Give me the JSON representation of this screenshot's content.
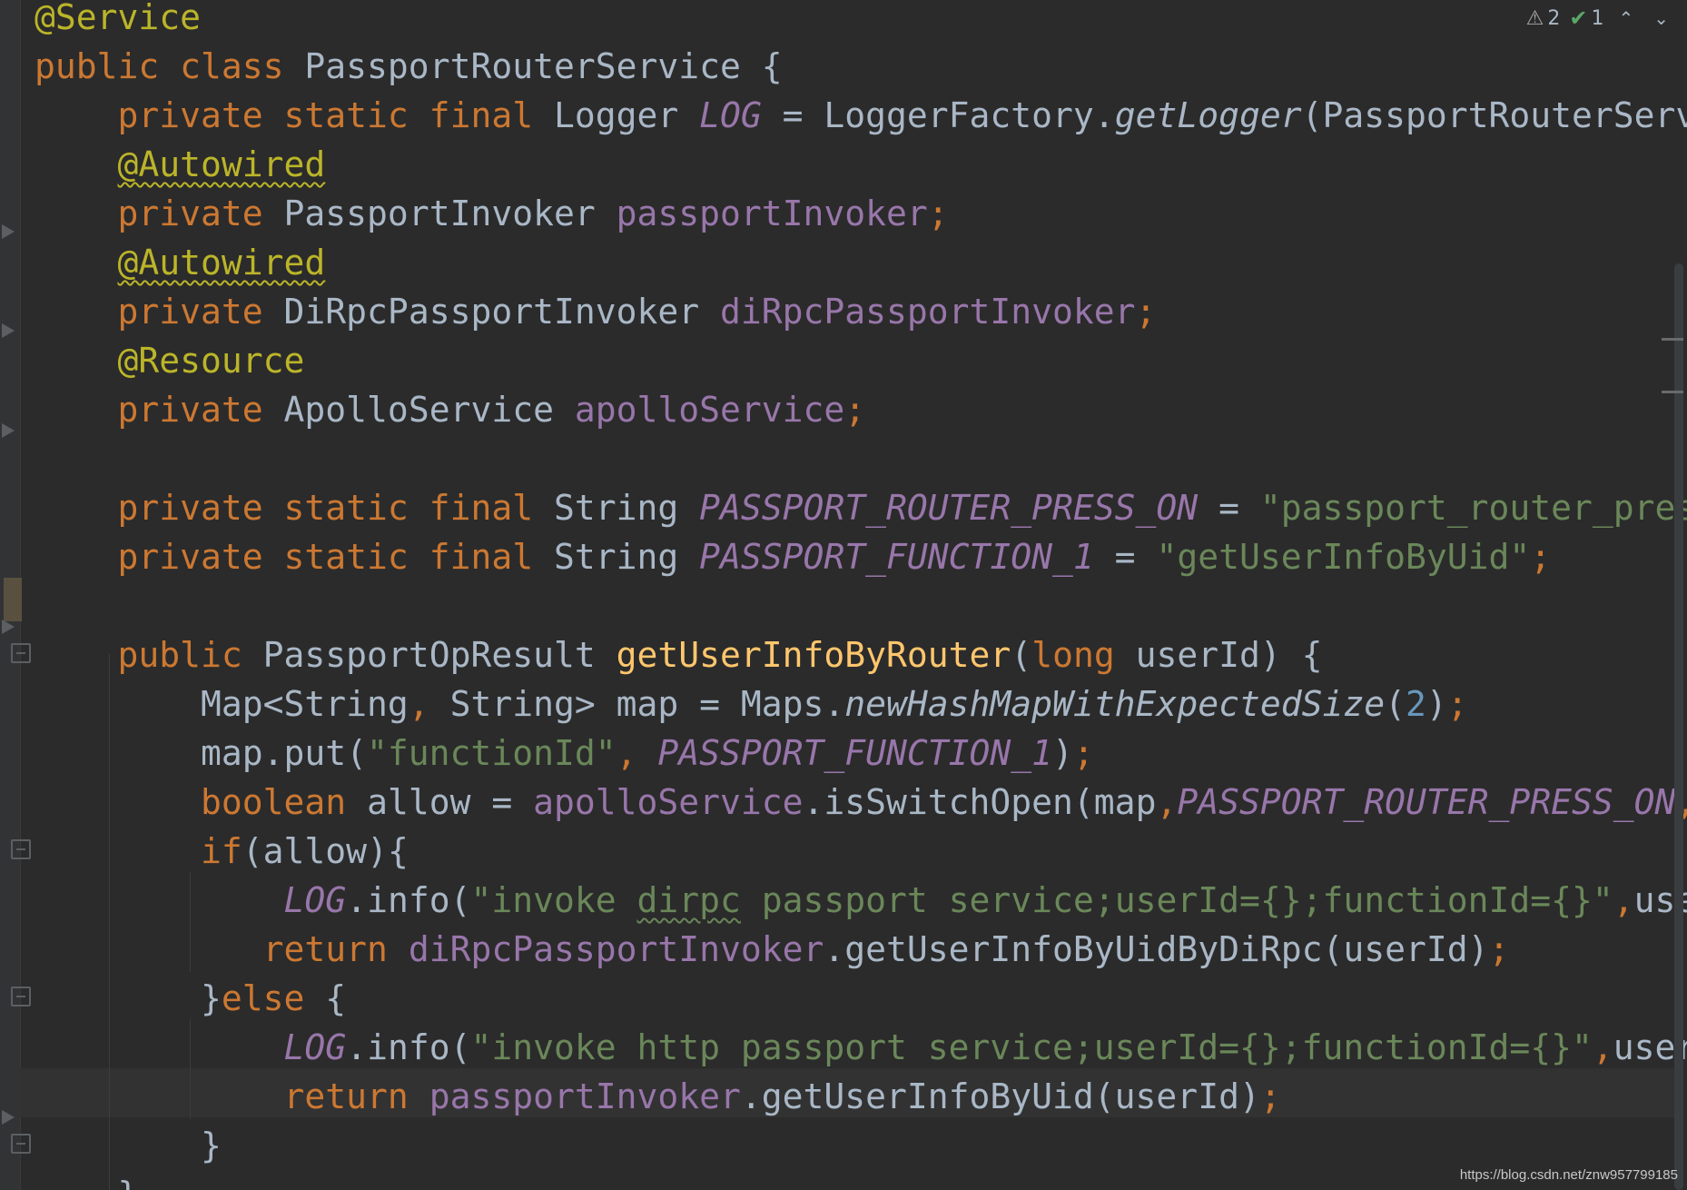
{
  "editor": {
    "language": "java",
    "lines": [
      [
        [
          "ann",
          "@Service"
        ]
      ],
      [
        [
          "kw",
          "public class "
        ],
        [
          "cls",
          "PassportRouterService "
        ],
        [
          "pl",
          "{"
        ]
      ],
      [
        [
          "pl",
          "    "
        ],
        [
          "kw",
          "private static final "
        ],
        [
          "cls",
          "Logger "
        ],
        [
          "sfld",
          "LOG"
        ],
        [
          "pl",
          " = LoggerFactory."
        ],
        [
          "sm",
          "getLogger"
        ],
        [
          "pl",
          "(PassportRouterService"
        ]
      ],
      [
        [
          "pl",
          "    "
        ],
        [
          "ann sq-y",
          "@Autowired"
        ]
      ],
      [
        [
          "pl",
          "    "
        ],
        [
          "kw",
          "private "
        ],
        [
          "cls",
          "PassportInvoker "
        ],
        [
          "fld",
          "passportInvoker"
        ],
        [
          "kw",
          ";"
        ]
      ],
      [
        [
          "pl",
          "    "
        ],
        [
          "ann sq-y",
          "@Autowired"
        ]
      ],
      [
        [
          "pl",
          "    "
        ],
        [
          "kw",
          "private "
        ],
        [
          "cls",
          "DiRpcPassportInvoker "
        ],
        [
          "fld",
          "diRpcPassportInvoker"
        ],
        [
          "kw",
          ";"
        ]
      ],
      [
        [
          "pl",
          "    "
        ],
        [
          "ann",
          "@Resource"
        ]
      ],
      [
        [
          "pl",
          "    "
        ],
        [
          "kw",
          "private "
        ],
        [
          "cls",
          "ApolloService "
        ],
        [
          "fld",
          "apolloService"
        ],
        [
          "kw",
          ";"
        ]
      ],
      [
        [
          "pl",
          ""
        ]
      ],
      [
        [
          "pl",
          "    "
        ],
        [
          "kw",
          "private static final "
        ],
        [
          "cls",
          "String "
        ],
        [
          "sfld",
          "PASSPORT_ROUTER_PRESS_ON"
        ],
        [
          "pl",
          " = "
        ],
        [
          "str",
          "\"passport_router_press_o"
        ]
      ],
      [
        [
          "pl",
          "    "
        ],
        [
          "kw",
          "private static final "
        ],
        [
          "cls",
          "String "
        ],
        [
          "sfld",
          "PASSPORT_FUNCTION_1"
        ],
        [
          "pl",
          " = "
        ],
        [
          "str",
          "\"getUserInfoByUid\""
        ],
        [
          "kw",
          ";"
        ]
      ],
      [
        [
          "pl",
          ""
        ]
      ],
      [
        [
          "pl",
          "    "
        ],
        [
          "kw",
          "public "
        ],
        [
          "cls",
          "PassportOpResult "
        ],
        [
          "fn",
          "getUserInfoByRouter"
        ],
        [
          "pl",
          "("
        ],
        [
          "kw",
          "long "
        ],
        [
          "pl",
          "userId) {"
        ]
      ],
      [
        [
          "pl",
          "        Map<String"
        ],
        [
          "kw",
          ", "
        ],
        [
          "pl",
          "String> map = Maps."
        ],
        [
          "sm",
          "newHashMapWithExpectedSize"
        ],
        [
          "pl",
          "("
        ],
        [
          "num",
          "2"
        ],
        [
          "pl",
          ")"
        ],
        [
          "kw",
          ";"
        ]
      ],
      [
        [
          "pl",
          "        map.put("
        ],
        [
          "str",
          "\"functionId\""
        ],
        [
          "kw",
          ", "
        ],
        [
          "sfld",
          "PASSPORT_FUNCTION_1"
        ],
        [
          "pl",
          ")"
        ],
        [
          "kw",
          ";"
        ]
      ],
      [
        [
          "pl",
          "        "
        ],
        [
          "kw",
          "boolean "
        ],
        [
          "pl",
          "allow = "
        ],
        [
          "fld",
          "apolloService"
        ],
        [
          "pl",
          ".isSwitchOpen(map"
        ],
        [
          "kw",
          ","
        ],
        [
          "sfld",
          "PASSPORT_ROUTER_PRESS_ON"
        ],
        [
          "kw",
          ","
        ],
        [
          "pl",
          "Str"
        ]
      ],
      [
        [
          "pl",
          "        "
        ],
        [
          "kw",
          "if"
        ],
        [
          "pl",
          "(allow){"
        ]
      ],
      [
        [
          "pl",
          "            "
        ],
        [
          "sfld",
          "LOG"
        ],
        [
          "pl",
          ".info("
        ],
        [
          "str",
          "\"invoke "
        ],
        [
          "str sq-g",
          "dirpc"
        ],
        [
          "str",
          " passport service;userId={};functionId={}\""
        ],
        [
          "kw",
          ","
        ],
        [
          "pl",
          "userId"
        ]
      ],
      [
        [
          "pl",
          "           "
        ],
        [
          "kw",
          "return "
        ],
        [
          "fld",
          "diRpcPassportInvoker"
        ],
        [
          "pl",
          ".getUserInfoByUidByDiRpc(userId)"
        ],
        [
          "kw",
          ";"
        ]
      ],
      [
        [
          "pl",
          "        }"
        ],
        [
          "kw",
          "else "
        ],
        [
          "pl",
          "{"
        ]
      ],
      [
        [
          "pl",
          "            "
        ],
        [
          "sfld",
          "LOG"
        ],
        [
          "pl",
          ".info("
        ],
        [
          "str",
          "\"invoke http passport service;userId={};functionId={}\""
        ],
        [
          "kw",
          ","
        ],
        [
          "pl",
          "userId"
        ],
        [
          "kw",
          ","
        ]
      ],
      [
        [
          "pl",
          "            "
        ],
        [
          "kw",
          "return "
        ],
        [
          "fld",
          "passportInvoker"
        ],
        [
          "pl",
          ".getUserInfoByUid(userId)"
        ],
        [
          "kw",
          ";"
        ]
      ],
      [
        [
          "pl",
          "        }"
        ]
      ],
      [
        [
          "pl",
          "    }"
        ]
      ]
    ]
  },
  "inspection": {
    "warnings_count": "2",
    "typos_count": "1",
    "warning_icon": "warning-triangle-icon",
    "typo_icon": "check-typo-icon",
    "prev_icon": "chevron-up-icon",
    "next_icon": "chevron-down-icon",
    "warning_glyph": "⚠",
    "typo_glyph": "✔",
    "prev_glyph": "⌃",
    "next_glyph": "⌄"
  },
  "watermark": "https://blog.csdn.net/znw957799185",
  "colors": {
    "background": "#2b2b2b",
    "keyword": "#cc7832",
    "annotation": "#bbb529",
    "field": "#9876aa",
    "method_decl": "#ffc66d",
    "string": "#6a8759",
    "number": "#6897bb",
    "plain": "#a9b7c6"
  }
}
